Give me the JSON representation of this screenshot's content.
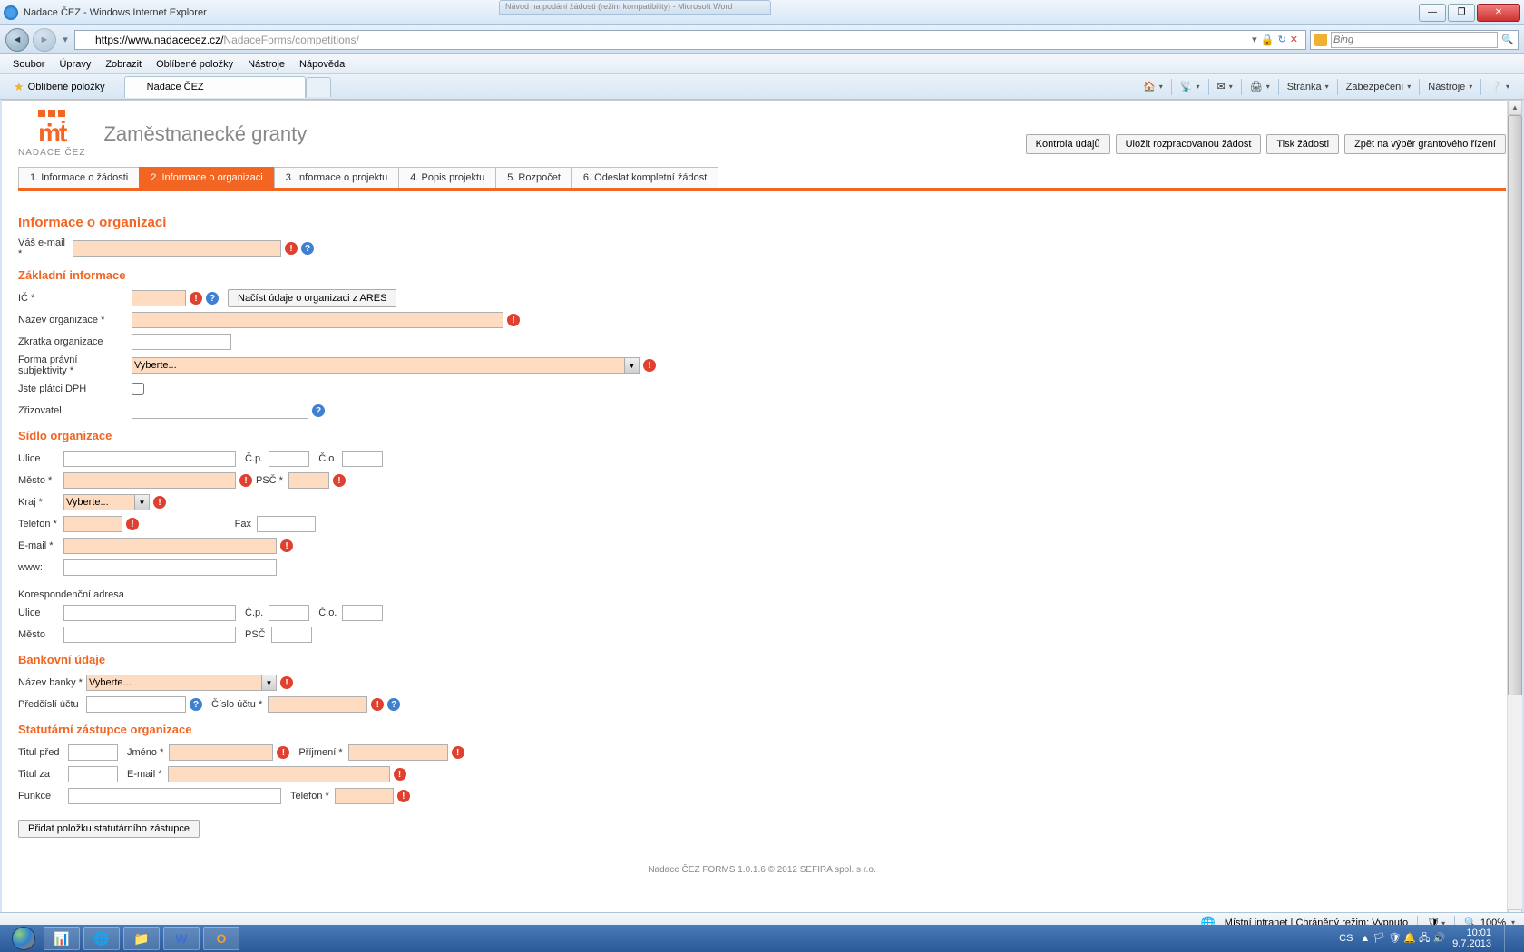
{
  "window": {
    "title": "Nadace ČEZ - Windows Internet Explorer",
    "bg_window": "Návod na podání žádosti (režim kompatibility) - Microsoft Word"
  },
  "nav": {
    "url_prefix": "https://www.nadacecez.cz/",
    "url_gray": "NadaceForms/competitions/",
    "search_placeholder": "Bing"
  },
  "menu": {
    "items": [
      "Soubor",
      "Úpravy",
      "Zobrazit",
      "Oblíbené položky",
      "Nástroje",
      "Nápověda"
    ]
  },
  "favbar": {
    "favorites": "Oblíbené položky",
    "tab_title": "Nadace ČEZ",
    "toolbar_page": "Stránka",
    "toolbar_safety": "Zabezpečení",
    "toolbar_tools": "Nástroje"
  },
  "page": {
    "logo_text": "NADACE ČEZ",
    "title": "Zaměstnanecké granty",
    "actions": {
      "check": "Kontrola údajů",
      "save": "Uložit rozpracovanou žádost",
      "print": "Tisk žádosti",
      "back": "Zpět na výběr grantového řízení"
    },
    "steps": [
      "1. Informace o žádosti",
      "2. Informace o organizaci",
      "3. Informace o projektu",
      "4. Popis projektu",
      "5. Rozpočet",
      "6. Odeslat kompletní žádost"
    ],
    "section_main": "Informace o organizaci",
    "email_label": "Váš e-mail *",
    "basic": {
      "heading": "Základní informace",
      "ic": "IČ *",
      "ares_btn": "Načíst údaje o organizaci z ARES",
      "org_name": "Název organizace *",
      "abbrev": "Zkratka organizace",
      "legal_form": "Forma právní subjektivity *",
      "select_default": "Vyberte...",
      "vat": "Jste plátci DPH",
      "founder": "Zřizovatel"
    },
    "address": {
      "heading": "Sídlo organizace",
      "street": "Ulice",
      "cp": "Č.p.",
      "co": "Č.o.",
      "city": "Město *",
      "psc": "PSČ *",
      "region": "Kraj *",
      "phone": "Telefon *",
      "fax": "Fax",
      "email": "E-mail *",
      "www": "www:",
      "corr": "Korespondenční adresa",
      "city2": "Město",
      "psc2": "PSČ"
    },
    "bank": {
      "heading": "Bankovní údaje",
      "bank_name": "Název banky *",
      "prefix": "Předčíslí účtu",
      "account": "Číslo účtu *"
    },
    "stat": {
      "heading": "Statutární zástupce organizace",
      "title_before": "Titul před",
      "name": "Jméno *",
      "surname": "Příjmení *",
      "title_after": "Titul za",
      "email": "E-mail *",
      "func": "Funkce",
      "phone": "Telefon *",
      "add_btn": "Přidat položku statutárního zástupce"
    },
    "footer": "Nadace ČEZ FORMS 1.0.1.6 © 2012 SEFIRA spol. s r.o."
  },
  "status": {
    "intranet": "Místní intranet | Chráněný režim: Vypnuto",
    "zoom": "100%"
  },
  "tray": {
    "lang": "CS",
    "time": "10:01",
    "date": "9.7.2013"
  }
}
